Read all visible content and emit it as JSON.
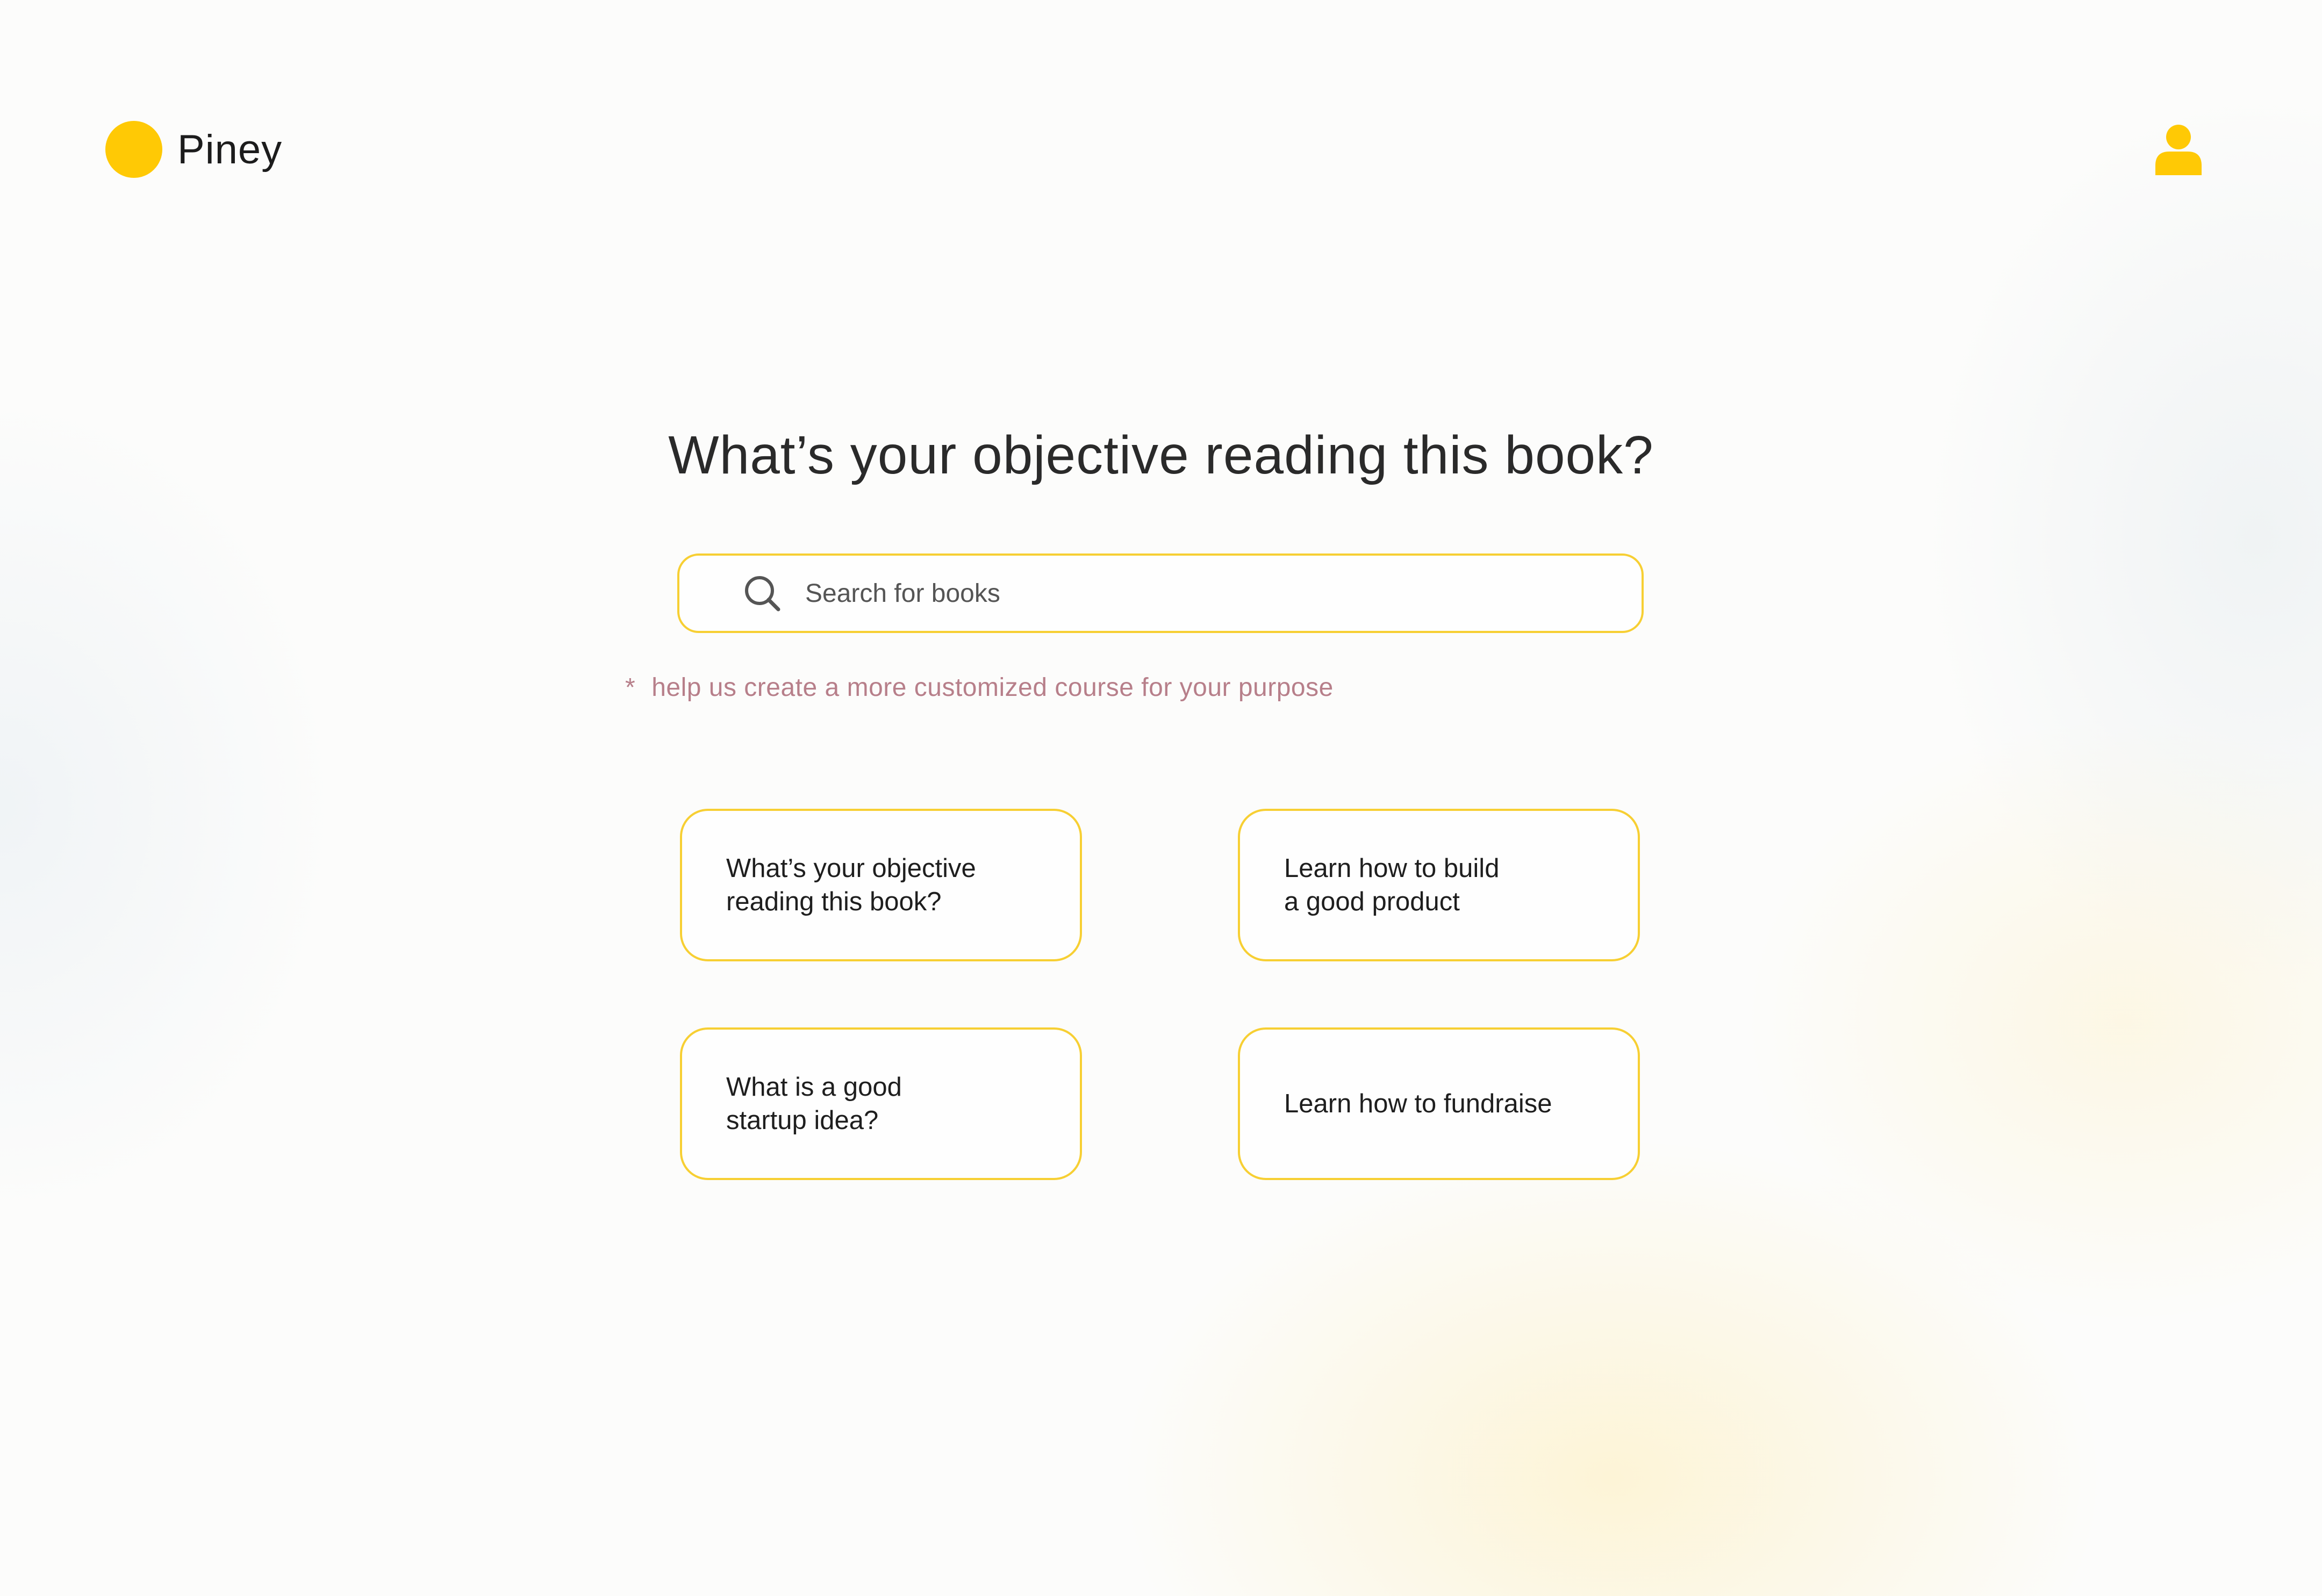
{
  "brand": {
    "name": "Piney",
    "color": "#ffc905"
  },
  "header": {
    "user_icon": "user-icon"
  },
  "main": {
    "title": "What’s your objective reading this book?",
    "search": {
      "placeholder": "Search for books",
      "value": "",
      "icon": "search-icon"
    },
    "hint": {
      "marker": "*",
      "text": "help us create a more customized course for your purpose"
    },
    "options": [
      {
        "label": "What’s your objective\nreading this book?"
      },
      {
        "label": "Learn how to build\na good product"
      },
      {
        "label": "What is a good\nstartup idea?"
      },
      {
        "label": "Learn how to fundraise"
      }
    ]
  },
  "colors": {
    "accent": "#ffc905",
    "border": "#f7cf33",
    "hint": "#b77f8a"
  }
}
